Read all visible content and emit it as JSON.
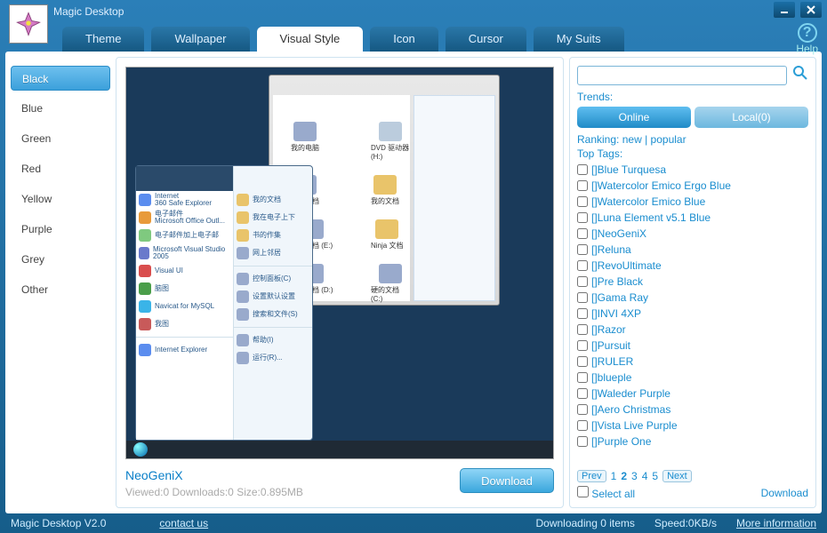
{
  "titlebar": {
    "app_title": "Magic Desktop"
  },
  "tabs": {
    "theme": "Theme",
    "wallpaper": "Wallpaper",
    "visual_style": "Visual Style",
    "icon": "Icon",
    "cursor": "Cursor",
    "my_suits": "My Suits"
  },
  "help": {
    "label": "Help",
    "icon": "?"
  },
  "sidebar": {
    "items": [
      {
        "label": "Black",
        "active": true
      },
      {
        "label": "Blue"
      },
      {
        "label": "Green"
      },
      {
        "label": "Red"
      },
      {
        "label": "Yellow"
      },
      {
        "label": "Purple"
      },
      {
        "label": "Grey"
      },
      {
        "label": "Other"
      }
    ]
  },
  "main": {
    "item_title": "NeoGeniX",
    "item_stats": "Viewed:0 Downloads:0 Size:0.895MB",
    "download_btn": "Download"
  },
  "right": {
    "search_placeholder": "",
    "trends_label": "Trends:",
    "online_btn": "Online",
    "local_btn": "Local(0)",
    "ranking_label": "Ranking:",
    "ranking_new": "new",
    "ranking_sep": "|",
    "ranking_popular": "popular",
    "top_tags_label": "Top Tags:",
    "tags": [
      "[]Blue Turquesa",
      "[]Watercolor Emico Ergo Blue",
      "[]Watercolor Emico Blue",
      "[]Luna Element v5.1 Blue",
      "[]NeoGeniX",
      "[]Reluna",
      "[]RevoUltimate",
      "[]Pre Black",
      "[]Gama Ray",
      "[]INVI 4XP",
      "[]Razor",
      "[]Pursuit",
      "[]RULER",
      "[]blueple",
      "[]Waleder Purple",
      "[]Aero Christmas",
      "[]Vista Live Purple",
      "[]Purple One"
    ],
    "pager": {
      "prev": "Prev",
      "next": "Next",
      "pages": [
        "1",
        "2",
        "3",
        "4",
        "5"
      ],
      "current": 2
    },
    "select_all": "Select all",
    "download": "Download"
  },
  "status": {
    "version": "Magic Desktop V2.0",
    "contact": "contact us",
    "downloading": "Downloading 0 items",
    "speed": "Speed:0KB/s",
    "more": "More information"
  }
}
